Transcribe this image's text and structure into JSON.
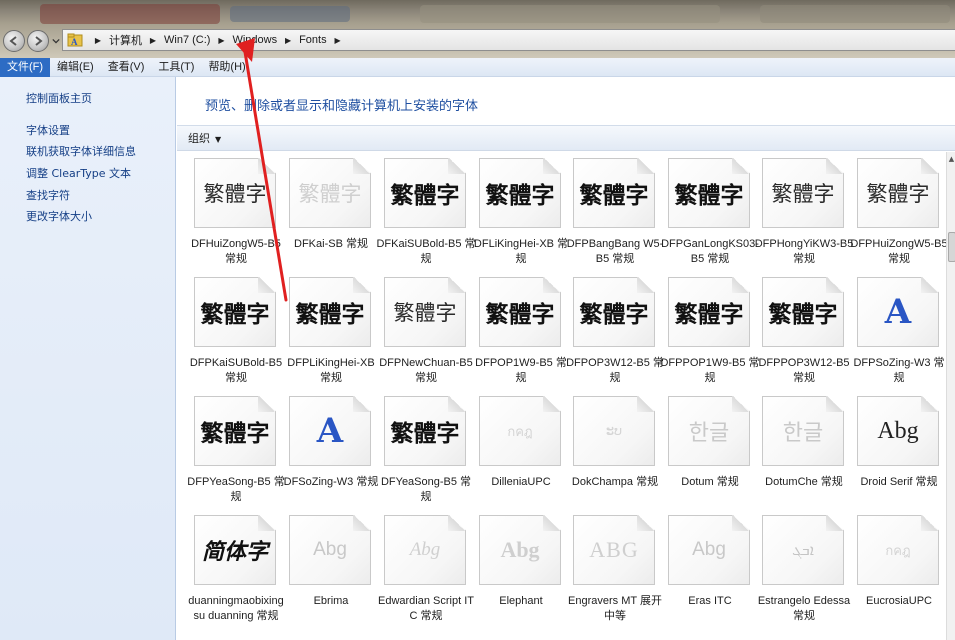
{
  "address": {
    "crumbs": [
      "计算机",
      "Win7 (C:)",
      "Windows",
      "Fonts"
    ]
  },
  "menu": {
    "items": [
      "文件(F)",
      "编辑(E)",
      "查看(V)",
      "工具(T)",
      "帮助(H)"
    ]
  },
  "sidebar": {
    "items": [
      "控制面板主页",
      "字体设置",
      "联机获取字体详细信息",
      "调整 ClearType 文本",
      "查找字符",
      "更改字体大小"
    ]
  },
  "main": {
    "description": "预览、删除或者显示和隐藏计算机上安装的字体",
    "toolbar_organize": "组织"
  },
  "fonts": [
    {
      "label": "DFHuiZongW5-B5 常规",
      "sample": "繁體字",
      "style": "s-dark"
    },
    {
      "label": "DFKai-SB 常规",
      "sample": "繁體字",
      "style": "s-light"
    },
    {
      "label": "DFKaiSUBold-B5 常规",
      "sample": "繁體字",
      "style": "s-black"
    },
    {
      "label": "DFLiKingHei-XB 常规",
      "sample": "繁體字",
      "style": "s-black"
    },
    {
      "label": "DFPBangBang W5-B5 常规",
      "sample": "繁體字",
      "style": "s-black"
    },
    {
      "label": "DFPGanLongKS03-B5 常规",
      "sample": "繁體字",
      "style": "s-black"
    },
    {
      "label": "DFPHongYiKW3-B5 常规",
      "sample": "繁體字",
      "style": "s-dark"
    },
    {
      "label": "DFPHuiZongW5-B5 常规",
      "sample": "繁體字",
      "style": "s-dark"
    },
    {
      "label": "DFPKaiSUBold-B5 常规",
      "sample": "繁體字",
      "style": "s-black"
    },
    {
      "label": "DFPLiKingHei-XB 常规",
      "sample": "繁體字",
      "style": "s-black"
    },
    {
      "label": "DFPNewChuan-B5 常规",
      "sample": "繁體字",
      "style": "s-dark"
    },
    {
      "label": "DFPOP1W9-B5 常规",
      "sample": "繁體字",
      "style": "s-black"
    },
    {
      "label": "DFPOP3W12-B5 常规",
      "sample": "繁體字",
      "style": "s-black"
    },
    {
      "label": "DFPPOP1W9-B5 常规",
      "sample": "繁體字",
      "style": "s-black"
    },
    {
      "label": "DFPPOP3W12-B5 常规",
      "sample": "繁體字",
      "style": "s-black"
    },
    {
      "label": "DFPSoZing-W3 常规",
      "sample": "A",
      "style": "s-blueA"
    },
    {
      "label": "DFPYeaSong-B5 常规",
      "sample": "繁體字",
      "style": "s-black"
    },
    {
      "label": "DFSoZing-W3 常规",
      "sample": "A",
      "style": "s-blueA"
    },
    {
      "label": "DFYeaSong-B5 常规",
      "sample": "繁體字",
      "style": "s-black"
    },
    {
      "label": "DilleniaUPC",
      "sample": "กคฎ",
      "style": "s-thai"
    },
    {
      "label": "DokChampa 常规",
      "sample": "ະບ",
      "style": "s-lao"
    },
    {
      "label": "Dotum 常规",
      "sample": "한글",
      "style": "s-korean"
    },
    {
      "label": "DotumChe 常规",
      "sample": "한글",
      "style": "s-korean"
    },
    {
      "label": "Droid Serif 常规",
      "sample": "Abg",
      "style": "s-abg"
    },
    {
      "label": "duanningmaobixingsu duanning 常规",
      "sample": "简体字",
      "style": "s-duanning"
    },
    {
      "label": "Ebrima",
      "sample": "Abg",
      "style": "s-abg-light"
    },
    {
      "label": "Edwardian Script ITC 常规",
      "sample": "Abg",
      "style": "s-abg-italic"
    },
    {
      "label": "Elephant",
      "sample": "Abg",
      "style": "s-abg-bold"
    },
    {
      "label": "Engravers MT 展开 中等",
      "sample": "ABG",
      "style": "s-abg-caps"
    },
    {
      "label": "Eras ITC",
      "sample": "Abg",
      "style": "s-abg-light"
    },
    {
      "label": "Estrangelo Edessa 常规",
      "sample": "ܐܒܓ",
      "style": "s-syriac"
    },
    {
      "label": "EucrosiaUPC",
      "sample": "กคฎ",
      "style": "s-thai"
    }
  ]
}
